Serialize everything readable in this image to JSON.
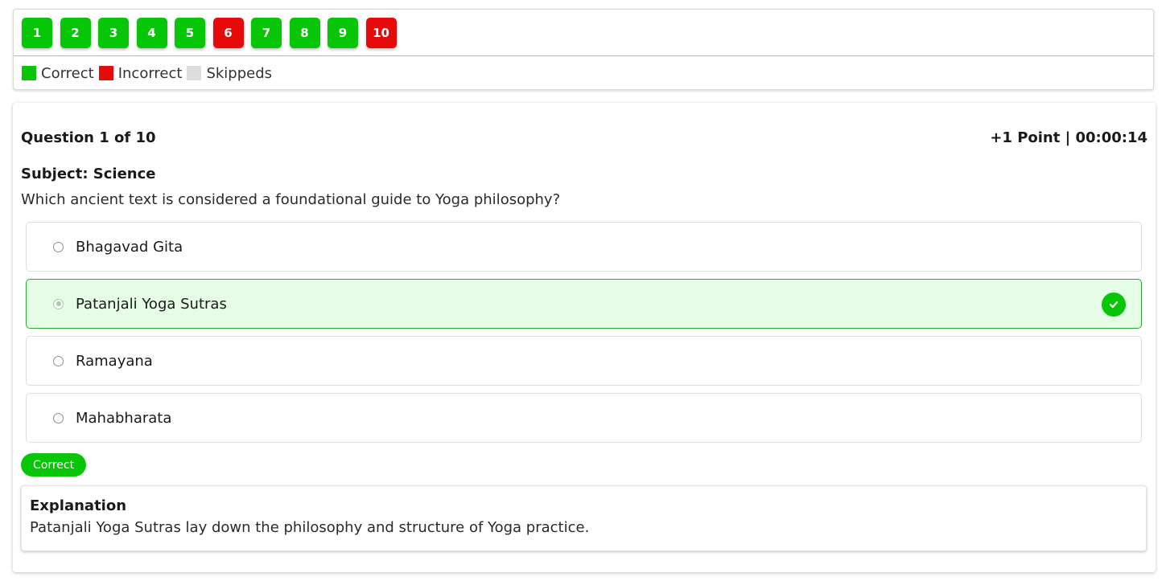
{
  "navigator": {
    "questions": [
      {
        "label": "1",
        "status": "correct"
      },
      {
        "label": "2",
        "status": "correct"
      },
      {
        "label": "3",
        "status": "correct"
      },
      {
        "label": "4",
        "status": "correct"
      },
      {
        "label": "5",
        "status": "correct"
      },
      {
        "label": "6",
        "status": "incorrect"
      },
      {
        "label": "7",
        "status": "correct"
      },
      {
        "label": "8",
        "status": "correct"
      },
      {
        "label": "9",
        "status": "correct"
      },
      {
        "label": "10",
        "status": "incorrect"
      }
    ],
    "legend": {
      "correct": "Correct",
      "incorrect": "Incorrect",
      "skipped": "Skippeds"
    }
  },
  "colors": {
    "correct": "#07c607",
    "incorrect": "#e60a0a",
    "skipped": "#dddddd",
    "correct_option_bg": "#e5fce5"
  },
  "question": {
    "counter": "Question 1 of 10",
    "meta": "+1 Point | 00:00:14",
    "subject": "Subject: Science",
    "text": "Which ancient text is considered a foundational guide to Yoga philosophy?",
    "options": [
      {
        "label": "Bhagavad Gita"
      },
      {
        "label": "Patanjali Yoga Sutras"
      },
      {
        "label": "Ramayana"
      },
      {
        "label": "Mahabharata"
      }
    ],
    "selected_index": 1,
    "correct_index": 1
  },
  "result": {
    "label": "Correct"
  },
  "explanation": {
    "title": "Explanation",
    "text": "Patanjali Yoga Sutras lay down the philosophy and structure of Yoga practice."
  }
}
